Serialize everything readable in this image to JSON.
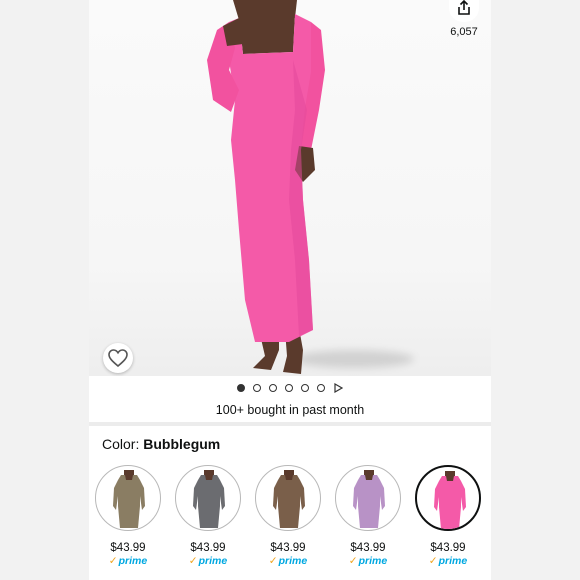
{
  "product": {
    "share_count": "6,057",
    "bought_text": "100+ bought in past month",
    "carousel": {
      "dot_count": 6,
      "active_index": 0
    }
  },
  "color": {
    "label": "Color:",
    "selected": "Bubblegum"
  },
  "variants": [
    {
      "price": "$43.99",
      "prime": "prime",
      "swatch_color": "#8a7d63"
    },
    {
      "price": "$43.99",
      "prime": "prime",
      "swatch_color": "#6b6c70"
    },
    {
      "price": "$43.99",
      "prime": "prime",
      "swatch_color": "#7a5f4a"
    },
    {
      "price": "$43.99",
      "prime": "prime",
      "swatch_color": "#b892c6"
    },
    {
      "price": "$43.99",
      "prime": "prime",
      "swatch_color": "#f45aa8",
      "selected": true
    }
  ],
  "colors": {
    "dress_main": "#f45aa8",
    "skin": "#5a3a2c",
    "prime_blue": "#00a8e1",
    "prime_check": "#f0a41e"
  },
  "icons": {
    "favorite": "heart-outline-icon",
    "share": "share-icon",
    "video": "play-icon"
  }
}
